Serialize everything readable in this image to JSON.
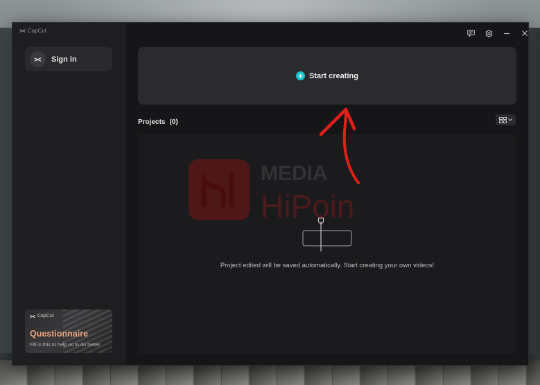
{
  "app": {
    "brand": "CapCut"
  },
  "sidebar": {
    "sign_in_label": "Sign in",
    "promo": {
      "brand": "CapCut",
      "title": "Questionnaire",
      "subtitle": "Fill in this to help us to do better"
    }
  },
  "titlebar": {
    "icons": [
      "feedback-icon",
      "settings-icon",
      "minimize-icon",
      "close-icon"
    ]
  },
  "main": {
    "create_label": "Start creating",
    "projects_title": "Projects",
    "projects_count": "(0)",
    "empty_message": "Project edited will be saved automatically. Start creating your own videos!"
  },
  "overlay": {
    "watermark": "MEDIA HiPoin",
    "accent_color": "#e0201b"
  },
  "colors": {
    "accent": "#16c3cf",
    "promo_title": "#e9a37b"
  }
}
